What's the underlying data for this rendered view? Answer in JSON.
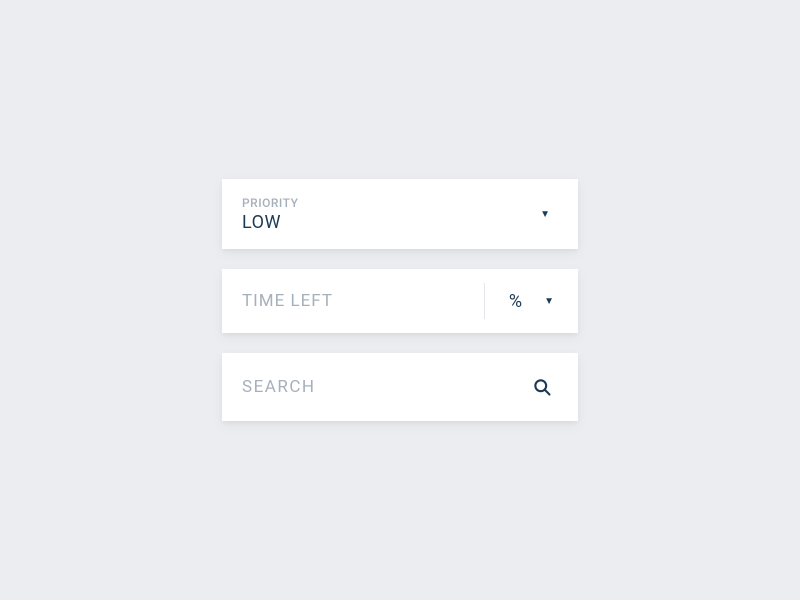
{
  "priority": {
    "label": "PRIORITY",
    "value": "LOW"
  },
  "timeLeft": {
    "placeholder": "TIME LEFT",
    "unit": "%"
  },
  "search": {
    "placeholder": "SEARCH"
  }
}
